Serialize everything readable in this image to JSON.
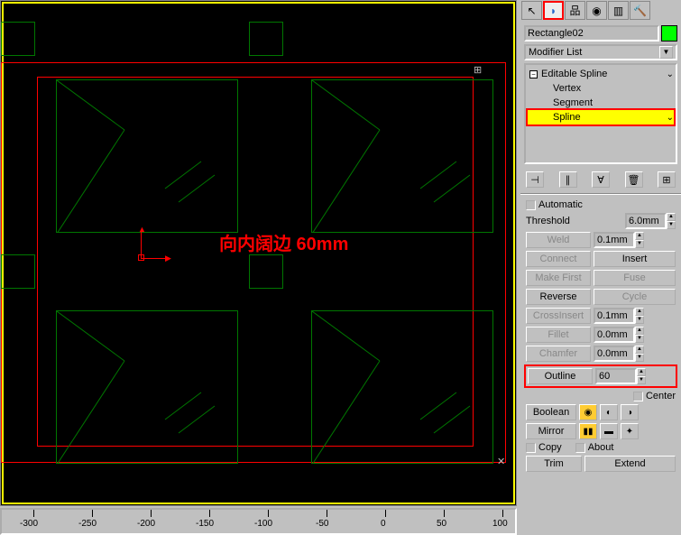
{
  "viewport": {
    "annotation": "向内阔边 60mm"
  },
  "panel": {
    "object_name": "Rectangle02",
    "modifier_dd": "Modifier List",
    "tree": {
      "root": "Editable Spline",
      "i0": "Vertex",
      "i1": "Segment",
      "i2": "Spline"
    },
    "automatic": "Automatic",
    "threshold_lbl": "Threshold",
    "threshold_val": "6.0mm",
    "weld_btn": "Weld",
    "weld_val": "0.1mm",
    "connect_btn": "Connect",
    "insert_btn": "Insert",
    "makefirst_btn": "Make First",
    "fuse_btn": "Fuse",
    "reverse_btn": "Reverse",
    "cycle_btn": "Cycle",
    "crossinsert_btn": "CrossInsert",
    "crossinsert_val": "0.1mm",
    "fillet_btn": "Fillet",
    "fillet_val": "0.0mm",
    "chamfer_btn": "Chamfer",
    "chamfer_val": "0.0mm",
    "outline_btn": "Outline",
    "outline_val": "60",
    "center_chk": "Center",
    "boolean_btn": "Boolean",
    "mirror_btn": "Mirror",
    "copy_chk": "Copy",
    "about_chk": "About",
    "trim_btn": "Trim",
    "extend_btn": "Extend"
  },
  "ruler": {
    "labels": [
      "-300",
      "-250",
      "-200",
      "-150",
      "-100",
      "-50",
      "0",
      "50",
      "100"
    ]
  }
}
